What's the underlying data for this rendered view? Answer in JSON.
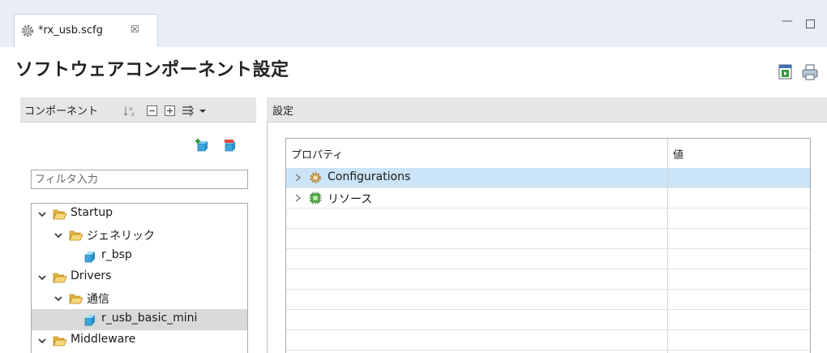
{
  "tab": {
    "label": "*rx_usb.scfg",
    "close_glyph": "☒",
    "icon": "gear-icon"
  },
  "window": {
    "minimize": "—"
  },
  "header": {
    "title": "ソフトウェアコンポーネント設定"
  },
  "left": {
    "title": "コンポーネント",
    "filter_placeholder": "フィルタ入力",
    "tree": [
      {
        "label": "Startup",
        "type": "folder",
        "level": 0,
        "expanded": true
      },
      {
        "label": "ジェネリック",
        "type": "folder",
        "level": 1,
        "expanded": true
      },
      {
        "label": "r_bsp",
        "type": "component",
        "level": 2
      },
      {
        "label": "Drivers",
        "type": "folder",
        "level": 0,
        "expanded": true
      },
      {
        "label": "通信",
        "type": "folder",
        "level": 1,
        "expanded": true
      },
      {
        "label": "r_usb_basic_mini",
        "type": "component",
        "level": 2,
        "selected": true
      },
      {
        "label": "Middleware",
        "type": "folder",
        "level": 0,
        "expanded": true
      }
    ]
  },
  "right": {
    "title": "設定",
    "columns": [
      "プロパティ",
      "値"
    ],
    "rows": [
      {
        "label": "Configurations",
        "icon": "gear-icon",
        "selected": true,
        "value": ""
      },
      {
        "label": "リソース",
        "icon": "chip-icon",
        "selected": false,
        "value": ""
      }
    ]
  },
  "colors": {
    "selection_blue": "#cce4f7",
    "selection_gray": "#d9d9d9",
    "folder": "#f0c24b"
  }
}
